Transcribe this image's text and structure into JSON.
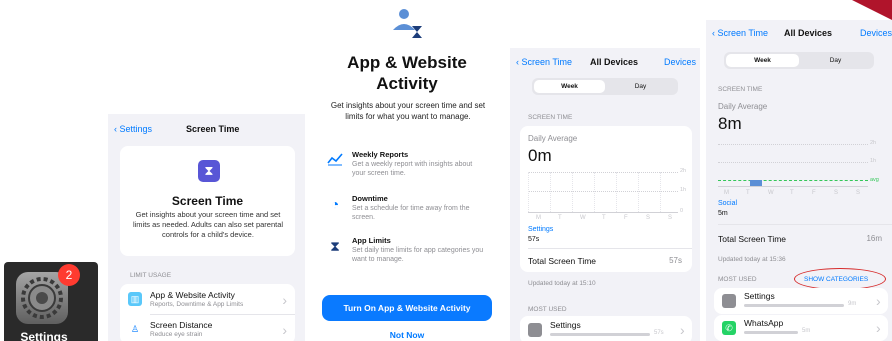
{
  "colors": {
    "accent": "#007aff",
    "badge": "#ff3b30",
    "screen_time_purple": "#5856d6",
    "annotation": "#d62b2b"
  },
  "home": {
    "app_label": "Settings",
    "badge_count": "2",
    "icon": "gear-icon"
  },
  "screen_time_settings": {
    "back_label": "Settings",
    "nav_title": "Screen Time",
    "card_title": "Screen Time",
    "card_description": "Get insights about your screen time and set limits as needed. Adults can also set parental controls for a child's device.",
    "section_header": "LIMIT USAGE",
    "rows": [
      {
        "title": "App & Website Activity",
        "subtitle": "Reports, Downtime & App Limits",
        "icon": "chart-icon"
      },
      {
        "title": "Screen Distance",
        "subtitle": "Reduce eye strain",
        "icon": "person-icon"
      }
    ]
  },
  "onboarding": {
    "title_line1": "App & Website",
    "title_line2": "Activity",
    "subtitle": "Get insights about your screen time and set limits for what you want to manage.",
    "features": [
      {
        "title": "Weekly Reports",
        "description": "Get a weekly report with insights about your screen time.",
        "icon": "chart-line-icon"
      },
      {
        "title": "Downtime",
        "description": "Set a schedule for time away from the screen.",
        "icon": "downtime-icon"
      },
      {
        "title": "App Limits",
        "description": "Set daily time limits for app categories you want to manage.",
        "icon": "hourglass-icon"
      }
    ],
    "primary_button": "Turn On App & Website Activity",
    "secondary_button": "Not Now"
  },
  "detail_a": {
    "back_label": "Screen Time",
    "nav_title": "All Devices",
    "nav_action": "Devices",
    "segments": [
      "Week",
      "Day"
    ],
    "section_header": "SCREEN TIME",
    "daily_average_label": "Daily Average",
    "daily_average_value": "0m",
    "y_ticks": [
      "2h",
      "1h",
      "0"
    ],
    "days": [
      "M",
      "T",
      "W",
      "T",
      "F",
      "S",
      "S"
    ],
    "category_label": "Settings",
    "category_value": "57s",
    "total_label": "Total Screen Time",
    "total_value": "57s",
    "updated": "Updated today at 15:10",
    "most_used_header": "MOST USED",
    "app_row": {
      "name": "Settings",
      "duration": "57s",
      "icon": "gear-icon"
    }
  },
  "detail_b": {
    "back_label": "Screen Time",
    "nav_title": "All Devices",
    "nav_action": "Devices",
    "segments": [
      "Week",
      "Day"
    ],
    "section_header": "SCREEN TIME",
    "daily_average_label": "Daily Average",
    "daily_average_value": "8m",
    "y_ticks": [
      "2h",
      "1h",
      "avg"
    ],
    "days": [
      "M",
      "T",
      "W",
      "T",
      "F",
      "S",
      "S"
    ],
    "category_label": "Social",
    "category_value": "5m",
    "total_label": "Total Screen Time",
    "total_value": "16m",
    "updated": "Updated today at 15:36",
    "most_used_header": "MOST USED",
    "show_categories": "SHOW CATEGORIES",
    "apps": [
      {
        "name": "Settings",
        "duration": "9m",
        "icon": "gear-icon"
      },
      {
        "name": "WhatsApp",
        "duration": "5m",
        "icon": "whatsapp-icon"
      }
    ]
  }
}
